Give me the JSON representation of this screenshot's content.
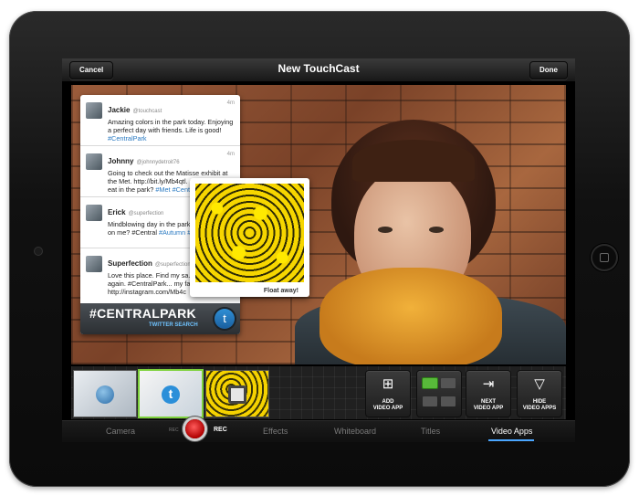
{
  "navbar": {
    "cancel_label": "Cancel",
    "title": "New TouchCast",
    "done_label": "Done"
  },
  "twitter_widget": {
    "tweets": [
      {
        "name": "Jackie",
        "handle": "@touchcast",
        "time": "4m",
        "text": "Amazing colors in the park today. Enjoying a perfect day with friends. Life is good!",
        "hashtags": "#CentralPark"
      },
      {
        "name": "Johnny",
        "handle": "@johnnydetroit76",
        "time": "4m",
        "text": "Going to check out the Matisse exhibit at the Met. http://bit.ly/Mb4qtl. Good places to eat in the park?",
        "hashtags": "#Met #CentralPark"
      },
      {
        "name": "Erick",
        "handle": "@superfection",
        "time": "",
        "text": "Mindblowing day in the park... fall creep up on me? #Central",
        "hashtags": "#Autumn #LeafMadness"
      },
      {
        "name": "Superfection",
        "handle": "@superfection",
        "time": "",
        "text": "Love this place. Find my sa... again and again. #CentralPark... my favorites. http://instagram.com/Mb4c",
        "hashtags": ""
      }
    ],
    "hashtag_title": "#CENTRALPARK",
    "subtitle": "TWITTER SEARCH"
  },
  "photo_popup": {
    "caption": "Float away!"
  },
  "toolbar": {
    "add_video_app_label": "ADD\nVIDEO APP",
    "next_video_app_label": "NEXT\nVIDEO APP",
    "hide_video_apps_label": "HIDE\nVIDEO APPS"
  },
  "tabs": {
    "camera": "Camera",
    "rec_prefix": "REC",
    "rec": "REC",
    "effects": "Effects",
    "whiteboard": "Whiteboard",
    "titles": "Titles",
    "video_apps": "Video Apps"
  },
  "colors": {
    "accent": "#4aa6ff",
    "record": "#e01e1e",
    "active_green": "#58b93a"
  }
}
